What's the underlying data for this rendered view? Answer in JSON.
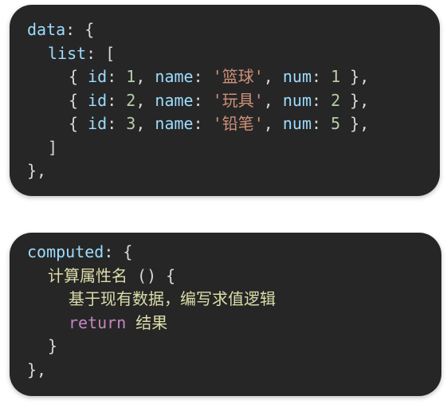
{
  "data_block": {
    "line1": {
      "key": "data",
      "open": ": {"
    },
    "line2": {
      "key": "list",
      "open": ": ["
    },
    "items": [
      {
        "id_key": "id",
        "id_val": "1",
        "name_key": "name",
        "name_val": "'篮球'",
        "num_key": "num",
        "num_val": "1"
      },
      {
        "id_key": "id",
        "id_val": "2",
        "name_key": "name",
        "name_val": "'玩具'",
        "num_key": "num",
        "num_val": "2"
      },
      {
        "id_key": "id",
        "id_val": "3",
        "name_key": "name",
        "name_val": "'铅笔'",
        "num_key": "num",
        "num_val": "5"
      }
    ],
    "close_list": "]",
    "close_data": "},"
  },
  "computed_block": {
    "key": "computed",
    "open": ": {",
    "method_name": "计算属性名",
    "method_sig": " () {",
    "body_text": "基于现有数据，编写求值逻辑",
    "return_kw": "return",
    "return_val": " 结果",
    "close_method": "}",
    "close_computed": "},"
  },
  "colors": {
    "panel_bg": "#262626",
    "key": "#9cdcfe",
    "number": "#b5cea8",
    "string": "#ce9178",
    "function": "#dcdcaa",
    "return_keyword": "#c586c0"
  }
}
